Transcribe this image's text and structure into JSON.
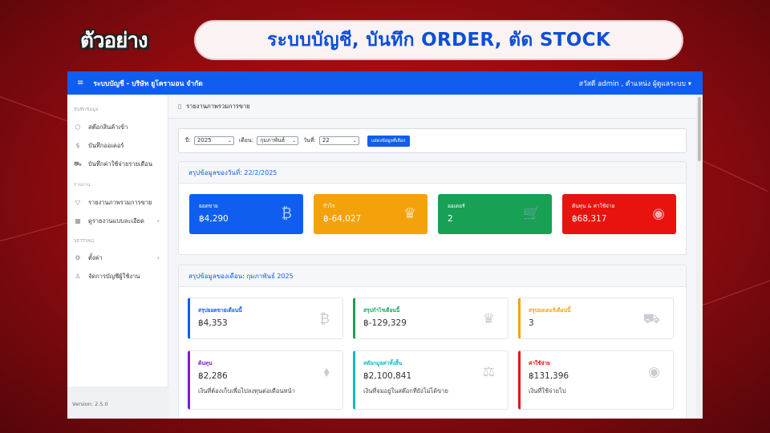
{
  "banner": {
    "logo_text": "ตัวอย่าง",
    "headline": "ระบบบัญชี, บันทึก ORDER, ตัด STOCK"
  },
  "topbar": {
    "menu_icon": "hamburger-icon",
    "title": "ระบบบัญชี - บริษัท ยูโครามอน จำกัด",
    "user": "สวัสดี admin , ตำแหน่ง ผู้ดูแลระบบ ▾"
  },
  "sidebar": {
    "sections": [
      {
        "title": "บันทึกข้อมูล",
        "items": [
          {
            "label": "สต๊อกสินค้าเข้า",
            "icon": "box-icon"
          },
          {
            "label": "บันทึกออเดอร์",
            "icon": "dollar-icon"
          },
          {
            "label": "บันทึกค่าใช้จ่ายรายเดือน",
            "icon": "cart-icon"
          }
        ]
      },
      {
        "title": "รายงาน",
        "items": [
          {
            "label": "รายงานภาพรวมการขาย",
            "icon": "filter-icon"
          },
          {
            "label": "ดูรายงานแบบละเอียด",
            "icon": "grid-icon"
          }
        ]
      },
      {
        "title": "SETTING",
        "items": [
          {
            "label": "ตั้งค่า",
            "icon": "gear-icon"
          },
          {
            "label": "จัดการบัญชีผู้ใช้งาน",
            "icon": "user-icon"
          }
        ]
      }
    ],
    "version": "Version: 2.5.0"
  },
  "page": {
    "title": "รายงานภาพรวมการขาย"
  },
  "filter": {
    "year_label": "ปี:",
    "year_value": "2025",
    "month_label": "เดือน:",
    "month_value": "กุมภาพันธ์",
    "day_label": "วันที่:",
    "day_value": "22",
    "submit_label": "แสดงข้อมูลที่เลือก"
  },
  "daily": {
    "heading": "สรุปข้อมูลของวันที่: 22/2/2025",
    "cards": [
      {
        "label": "ยอดขาย",
        "value": "฿4,290",
        "color": "#0f5ef0",
        "icon": "bitcoin-icon"
      },
      {
        "label": "กำไร",
        "value": "฿-64,027",
        "color": "#f4a20c",
        "icon": "trophy-icon"
      },
      {
        "label": "ออเดอร์",
        "value": "2",
        "color": "#18a055",
        "icon": "cart-plus-icon"
      },
      {
        "label": "ต้นทุน & ค่าใช้จ่าย",
        "value": "฿68,317",
        "color": "#e8130f",
        "icon": "coins-icon"
      }
    ]
  },
  "monthly": {
    "heading": "สรุปข้อมูลของเดือน: กุมภาพันธ์ 2025",
    "cards": [
      {
        "label": "สรุปยอดขายเดือนนี้",
        "value": "฿4,353",
        "sub": "",
        "color": "#0f5ef0",
        "icon": "bitcoin-icon"
      },
      {
        "label": "สรุปกำไรเดือนนี้",
        "value": "฿-129,329",
        "sub": "",
        "color": "#18a055",
        "icon": "trophy-icon"
      },
      {
        "label": "สรุปออเดอร์เดือนนี้",
        "value": "3",
        "sub": "",
        "color": "#f4a20c",
        "icon": "cart-icon"
      },
      {
        "label": "ต้นทุน",
        "value": "฿2,286",
        "sub": "เงินที่ต้องเก็บเพื่อไปลงทุนต่อเดือนหน้า",
        "color": "#7a1fc7",
        "icon": "tag-icon"
      },
      {
        "label": "สต๊อกมูลค่าทั้งสิ้น",
        "value": "฿2,100,841",
        "sub": "เงินที่จมอยู่ในสต๊อกที่ยังไม่ได้ขาย",
        "color": "#16b6c8",
        "icon": "scale-icon"
      },
      {
        "label": "ค่าใช้จ่าย",
        "value": "฿131,396",
        "sub": "เงินที่ใช้จ่ายไป",
        "color": "#e8130f",
        "icon": "coins-icon"
      }
    ]
  }
}
